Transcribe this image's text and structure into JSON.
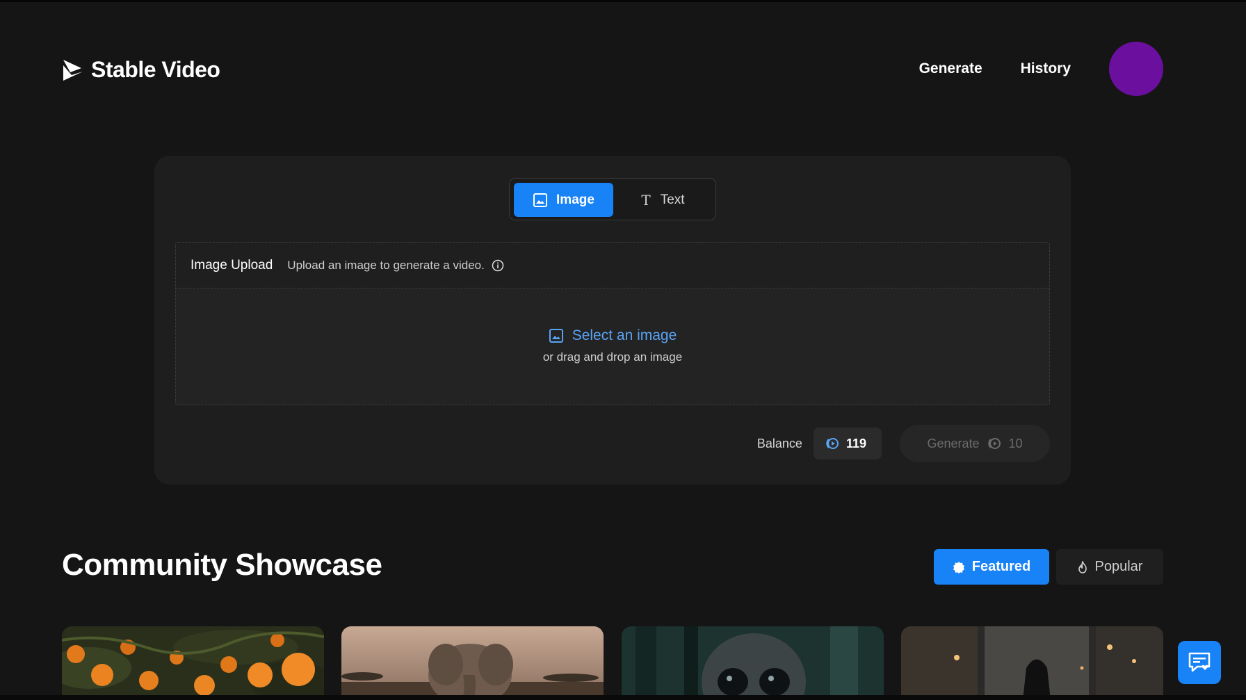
{
  "brand": {
    "name": "Stable Video",
    "icon": "play-flag-icon"
  },
  "nav": {
    "generate": "Generate",
    "history": "History"
  },
  "mode_tabs": {
    "image": "Image",
    "text": "Text",
    "selected": "Image"
  },
  "upload": {
    "title": "Image Upload",
    "description": "Upload an image to generate a video.",
    "select_label": "Select an image",
    "drag_label": "or drag and drop an image"
  },
  "balance": {
    "label": "Balance",
    "value": "119"
  },
  "generate_button": {
    "label": "Generate",
    "cost": "10"
  },
  "showcase": {
    "title": "Community Showcase",
    "filters": {
      "featured": "Featured",
      "popular": "Popular",
      "selected": "Featured"
    },
    "thumbnails": [
      "oranges-tree",
      "elephant",
      "alien-creature",
      "hooded-figure-alley"
    ]
  },
  "colors": {
    "accent": "#1882f7",
    "background": "#151515",
    "card": "#1e1e1e",
    "avatar": "#6b0f9e",
    "link": "#5aa4f5"
  }
}
